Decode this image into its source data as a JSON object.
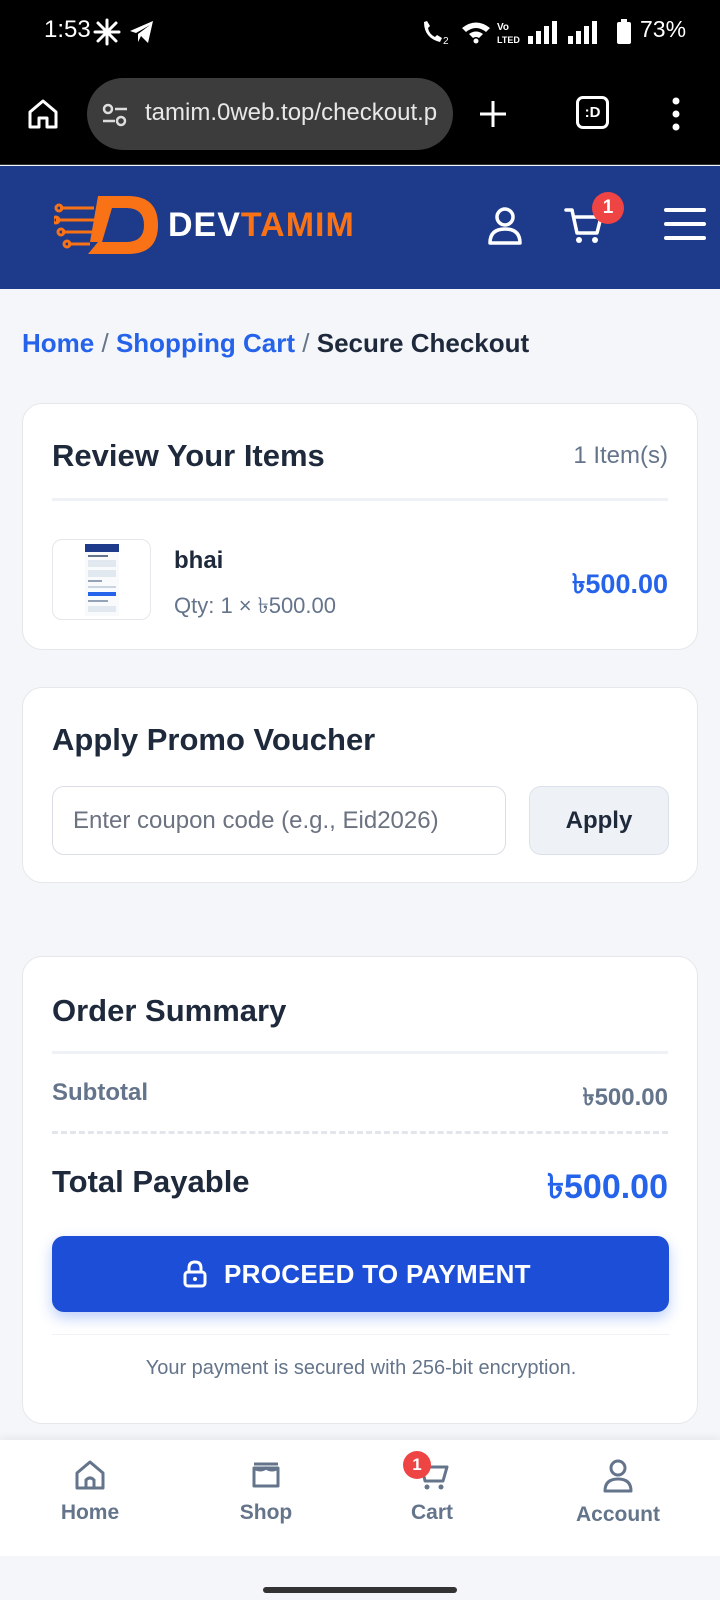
{
  "status_bar": {
    "time": "1:53",
    "battery": "73%",
    "icons": [
      "pinwheel-icon",
      "telegram-icon",
      "wifi-calling-icon",
      "wifi-icon",
      "volte-icon",
      "signal-icon",
      "signal-icon",
      "battery-icon"
    ]
  },
  "browser": {
    "url": "tamim.0web.top/checkout.p",
    "tab_switcher_label": ":D"
  },
  "header": {
    "logo_dev": "DEV",
    "logo_tamim": "TAMIM",
    "cart_count": "1",
    "brand_color": "#1e3a8a",
    "accent_color": "#f97316"
  },
  "breadcrumb": {
    "home": "Home",
    "cart": "Shopping Cart",
    "sep": "/",
    "current": "Secure Checkout"
  },
  "review": {
    "title": "Review Your Items",
    "count": "1 Item(s)",
    "items": [
      {
        "name": "bhai",
        "qty": "Qty: 1 × ৳500.00",
        "price": "৳500.00"
      }
    ]
  },
  "promo": {
    "title": "Apply Promo Voucher",
    "placeholder": "Enter coupon code (e.g., Eid2026)",
    "apply_label": "Apply"
  },
  "summary": {
    "title": "Order Summary",
    "subtotal_label": "Subtotal",
    "subtotal_value": "৳500.00",
    "total_label": "Total Payable",
    "total_value": "৳500.00",
    "pay_label": "PROCEED TO PAYMENT",
    "secure_note": "Your payment is secured with 256-bit encryption."
  },
  "bottom_nav": {
    "items": [
      {
        "label": "Home",
        "icon": "home-icon"
      },
      {
        "label": "Shop",
        "icon": "shop-icon"
      },
      {
        "label": "Cart",
        "icon": "cart-icon"
      },
      {
        "label": "Account",
        "icon": "user-icon"
      }
    ],
    "cart_badge": "1"
  },
  "colors": {
    "primary": "#2563eb",
    "badge": "#ef4444"
  }
}
